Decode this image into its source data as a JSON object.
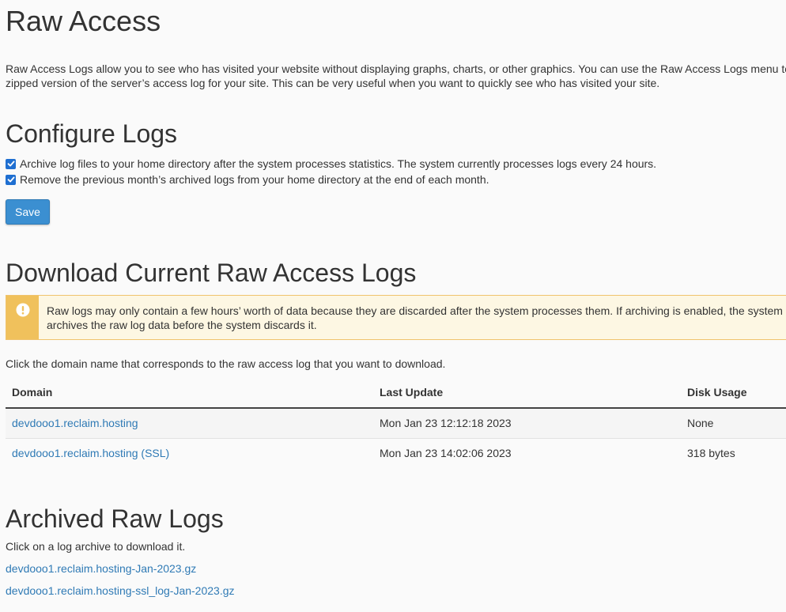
{
  "page": {
    "title": "Raw Access",
    "description": "Raw Access Logs allow you to see who has visited your website without displaying graphs, charts, or other graphics. You can use the Raw Access Logs menu to download a zipped version of the server’s access log for your site. This can be very useful when you want to quickly see who has visited your site."
  },
  "configure": {
    "title": "Configure Logs",
    "options": [
      {
        "label": "Archive log files to your home directory after the system processes statistics. The system currently processes logs every 24 hours.",
        "checked": true
      },
      {
        "label": "Remove the previous month’s archived logs from your home directory at the end of each month.",
        "checked": true
      }
    ],
    "save_label": "Save"
  },
  "download": {
    "title": "Download Current Raw Access Logs",
    "alert_text": "Raw logs may only contain a few hours’ worth of data because they are discarded after the system processes them. If archiving is enabled, the system archives the raw log data before the system discards it.",
    "hint": "Click the domain name that corresponds to the raw access log that you want to download.",
    "columns": [
      "Domain",
      "Last Update",
      "Disk Usage"
    ],
    "rows": [
      {
        "domain": "devdooo1.reclaim.hosting",
        "last_update": "Mon Jan 23 12:12:18 2023",
        "disk_usage": "None"
      },
      {
        "domain": "devdooo1.reclaim.hosting (SSL)",
        "last_update": "Mon Jan 23 14:02:06 2023",
        "disk_usage": "318 bytes"
      }
    ]
  },
  "archived": {
    "title": "Archived Raw Logs",
    "hint": "Click on a log archive to download it.",
    "links": [
      "devdooo1.reclaim.hosting-Jan-2023.gz",
      "devdooo1.reclaim.hosting-ssl_log-Jan-2023.gz"
    ]
  },
  "colors": {
    "link": "#2f7ab5",
    "button": "#3b8fd1",
    "alert_bg": "#fdf7e3",
    "alert_icon_bg": "#f0c15c"
  },
  "icons": {
    "alert": "exclamation-circle-icon",
    "checkbox": "checkmark-icon"
  }
}
